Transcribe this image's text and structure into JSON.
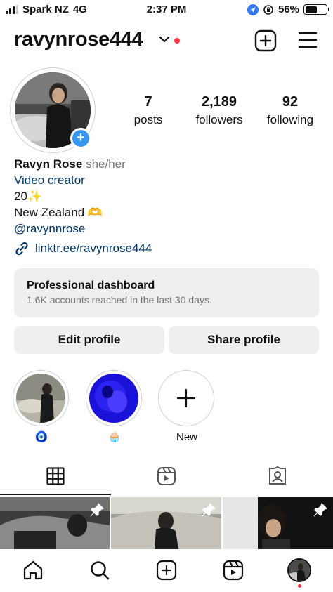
{
  "status_bar": {
    "carrier": "Spark NZ",
    "network": "4G",
    "time": "2:37 PM",
    "battery_percent": "56%",
    "battery_level": 0.56
  },
  "header": {
    "username": "ravynrose444"
  },
  "profile": {
    "stats": {
      "posts_count": "7",
      "posts_label": "posts",
      "followers_count": "2,189",
      "followers_label": "followers",
      "following_count": "92",
      "following_label": "following"
    },
    "bio": {
      "name": "Ravyn Rose",
      "pronouns": "she/her",
      "category": "Video creator",
      "line_age": "20✨",
      "line_location": "New Zealand 🫶",
      "handle": "@ravynnrose",
      "link": "linktr.ee/ravynrose444"
    }
  },
  "dashboard": {
    "title": "Professional dashboard",
    "subtitle": "1.6K accounts reached in the last 30 days."
  },
  "buttons": {
    "edit_profile": "Edit profile",
    "share_profile": "Share profile"
  },
  "highlights": [
    {
      "label": "🧿"
    },
    {
      "label": "🧁"
    },
    {
      "label": "New"
    }
  ],
  "colors": {
    "link": "#00376b",
    "accent_blue": "#3797f0",
    "notification_red": "#ff3040",
    "button_gray": "#efefef"
  }
}
